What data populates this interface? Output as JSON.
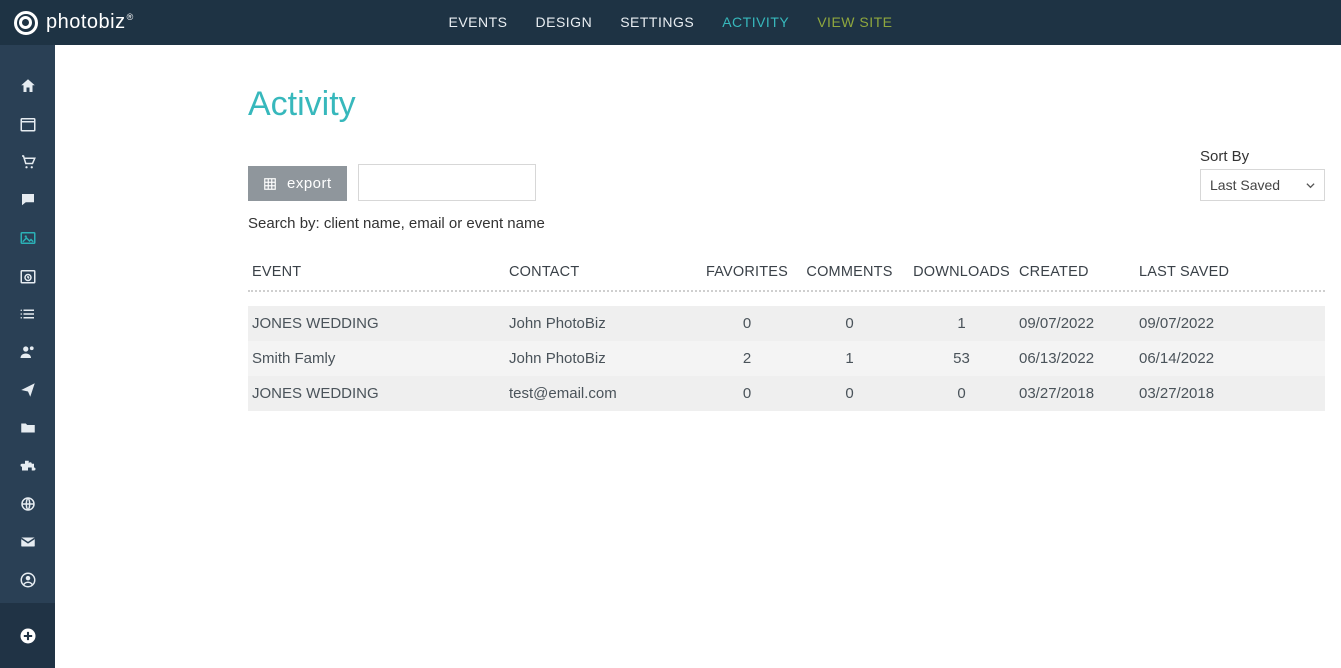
{
  "brand": {
    "name": "photobiz",
    "registered": "®"
  },
  "topnav": {
    "events": "EVENTS",
    "design": "DESIGN",
    "settings": "SETTINGS",
    "activity": "ACTIVITY",
    "viewsite": "VIEW SITE"
  },
  "page": {
    "title": "Activity",
    "export": "export",
    "search_placeholder": "",
    "search_help": "Search by: client name, email or event name",
    "sort_label": "Sort By",
    "sort_value": "Last Saved"
  },
  "columns": {
    "event": "EVENT",
    "contact": "CONTACT",
    "favorites": "FAVORITES",
    "comments": "COMMENTS",
    "downloads": "DOWNLOADS",
    "created": "CREATED",
    "last_saved": "LAST SAVED"
  },
  "rows": [
    {
      "event": "JONES WEDDING",
      "contact": "John PhotoBiz",
      "favorites": "0",
      "comments": "0",
      "downloads": "1",
      "created": "09/07/2022",
      "last_saved": "09/07/2022"
    },
    {
      "event": "Smith Famly",
      "contact": "John PhotoBiz",
      "favorites": "2",
      "comments": "1",
      "downloads": "53",
      "created": "06/13/2022",
      "last_saved": "06/14/2022"
    },
    {
      "event": "JONES WEDDING",
      "contact": "test@email.com",
      "favorites": "0",
      "comments": "0",
      "downloads": "0",
      "created": "03/27/2018",
      "last_saved": "03/27/2018"
    }
  ]
}
